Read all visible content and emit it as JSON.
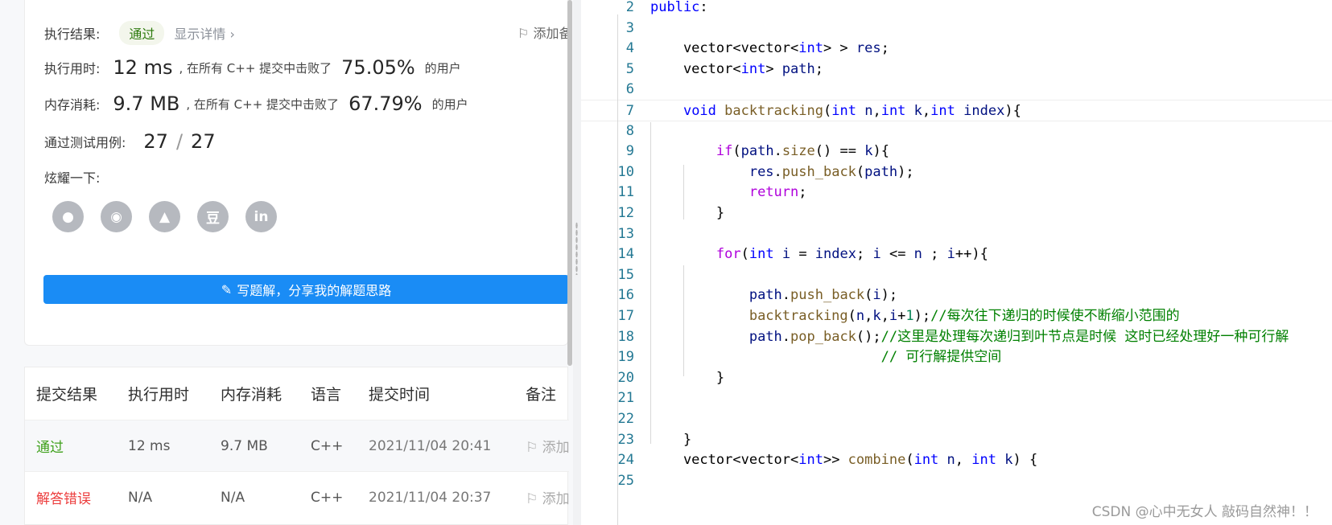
{
  "result": {
    "label": "执行结果:",
    "status": "通过",
    "details_link": "显示详情 ›",
    "add_note": "添加备注"
  },
  "runtime": {
    "label": "执行用时:",
    "value": "12 ms",
    "mid": ", 在所有 C++ 提交中击败了",
    "percent": "75.05%",
    "suffix": "的用户"
  },
  "memory": {
    "label": "内存消耗:",
    "value": "9.7 MB",
    "mid": ", 在所有 C++ 提交中击败了",
    "percent": "67.79%",
    "suffix": "的用户"
  },
  "testcases": {
    "label": "通过测试用例:",
    "passed": "27",
    "sep": "/",
    "total": "27"
  },
  "share": {
    "label": "炫耀一下:",
    "icons": [
      "wechat-icon",
      "weibo-icon",
      "qq-icon",
      "douban-icon",
      "linkedin-icon"
    ],
    "icon_glyphs": [
      "●",
      "◉",
      "▲",
      "豆",
      "in"
    ]
  },
  "write_solution": "写题解，分享我的解题思路",
  "submissions": {
    "headers": [
      "提交结果",
      "执行用时",
      "内存消耗",
      "语言",
      "提交时间",
      "备注"
    ],
    "rows": [
      {
        "result": "通过",
        "runtime": "12 ms",
        "memory": "9.7 MB",
        "lang": "C++",
        "time": "2021/11/04 20:41",
        "note": "添加备注"
      },
      {
        "result": "解答错误",
        "runtime": "N/A",
        "memory": "N/A",
        "lang": "C++",
        "time": "2021/11/04 20:37",
        "note": "添加备注"
      }
    ]
  },
  "code_lines": [
    {
      "n": "2",
      "t": "public:"
    },
    {
      "n": "3",
      "t": ""
    },
    {
      "n": "4",
      "t": "    vector<vector<int> > res;"
    },
    {
      "n": "5",
      "t": "    vector<int> path;"
    },
    {
      "n": "6",
      "t": ""
    },
    {
      "n": "7",
      "t": "    void backtracking(int n,int k,int index){"
    },
    {
      "n": "8",
      "t": ""
    },
    {
      "n": "9",
      "t": "        if(path.size() == k){"
    },
    {
      "n": "10",
      "t": "            res.push_back(path);"
    },
    {
      "n": "11",
      "t": "            return;"
    },
    {
      "n": "12",
      "t": "        }"
    },
    {
      "n": "13",
      "t": ""
    },
    {
      "n": "14",
      "t": "        for(int i = index; i <= n ; i++){"
    },
    {
      "n": "15",
      "t": ""
    },
    {
      "n": "16",
      "t": "            path.push_back(i);"
    },
    {
      "n": "17",
      "t": "            backtracking(n,k,i+1);//每次往下递归的时候使不断缩小范围的"
    },
    {
      "n": "18",
      "t": "            path.pop_back();//这里是处理每次递归到叶节点是时候 这时已经处理好一种可行解"
    },
    {
      "n": "19",
      "t": "                            // 可行解提供空间"
    },
    {
      "n": "20",
      "t": "        }"
    },
    {
      "n": "21",
      "t": ""
    },
    {
      "n": "22",
      "t": ""
    },
    {
      "n": "23",
      "t": "    }"
    },
    {
      "n": "24",
      "t": "    vector<vector<int>> combine(int n, int k) {"
    },
    {
      "n": "25",
      "t": ""
    }
  ],
  "watermark": "CSDN @心中无女人 敲码自然神！！"
}
